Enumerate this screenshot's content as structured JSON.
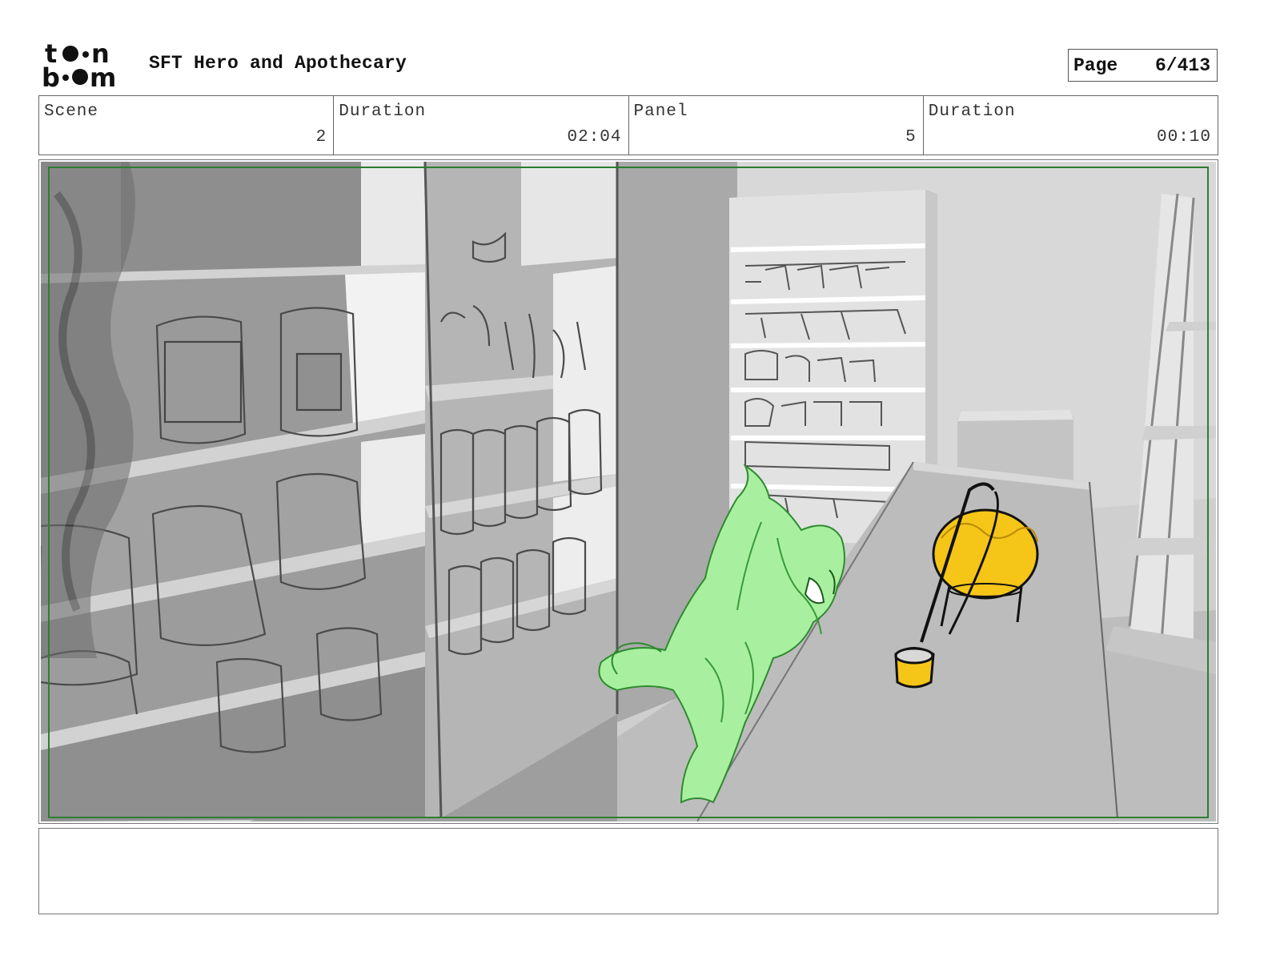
{
  "header": {
    "logo": "toon boom",
    "project_title": "SFT Hero and Apothecary",
    "page_label": "Page",
    "page_value": "6/413"
  },
  "info": {
    "scene_label": "Scene",
    "scene_value": "2",
    "scene_duration_label": "Duration",
    "scene_duration_value": "02:04",
    "panel_label": "Panel",
    "panel_value": "5",
    "panel_duration_label": "Duration",
    "panel_duration_value": "00:10"
  },
  "panel": {
    "frame_color": "#2e7d32",
    "character_color": "#a8f0a0",
    "potion_color": "#f5c518"
  },
  "notes": {
    "text": ""
  }
}
